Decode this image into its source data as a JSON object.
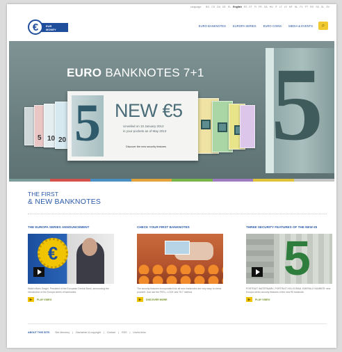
{
  "languages": {
    "label": "Language:",
    "items": [
      "BG",
      "CS",
      "DA",
      "DE",
      "EL",
      "English",
      "ES",
      "ET",
      "FI",
      "FR",
      "GA",
      "HU",
      "IT",
      "LT",
      "LV",
      "MT",
      "NL",
      "PL",
      "PT",
      "RO",
      "SK",
      "SL",
      "SV"
    ]
  },
  "logo": {
    "line1": "EUR",
    "line2": "MONEY"
  },
  "nav": [
    "EURO BANKNOTES",
    "EUROPA SERIES",
    "EURO COINS",
    "MEDIA & EVENTS"
  ],
  "hero": {
    "title_bold": "EURO",
    "title_rest": " BANKNOTES  7+1",
    "card": {
      "headline": "NEW €5",
      "line1": "Unveiled on 10 January 2013",
      "line2": "in your pockets as of May 2013",
      "link": "Discover the new security features"
    },
    "notes": [
      "5",
      "10",
      "20"
    ]
  },
  "colorbar": [
    "#7a9c9a",
    "#d4514b",
    "#4a8fc4",
    "#e2a13b",
    "#79b44a",
    "#9c7bc0",
    "#e0c23a",
    "#c4c4c4"
  ],
  "section": {
    "title_line1": "THE FIRST",
    "title_line2": "& NEW BANKNOTES"
  },
  "columns": [
    {
      "title": "THE EUROPA SERIES ANNOUNCEMENT",
      "description": "Watch Mario Draghi, President of the European Central Bank, announcing the introduction of the Europa series of banknotes.",
      "button": "PLAY VIDEO"
    },
    {
      "title": "CHECK YOUR FIRST BANKNOTES",
      "description": "The security features incorporated into all euro banknotes are very easy to check yourself. Just use the FEEL, LOOK and TILT method.",
      "button": "DISCOVER MORE"
    },
    {
      "title": "THREE SECURITY FEATURES OF THE NEW €5",
      "description": "PORTRAIT WATERMARK, PORTRAIT HOLOGRAM, EMERALD NUMBER: new Europa series security features of the new €5 banknote.",
      "button": "PLAY VIDEO"
    }
  ],
  "footer": {
    "about": "ABOUT THIS SITE:",
    "links": [
      "Site directory",
      "|",
      "Disclaimer & copyright",
      "|",
      "Contact",
      "|",
      "RSS",
      "|",
      "Useful links"
    ]
  }
}
